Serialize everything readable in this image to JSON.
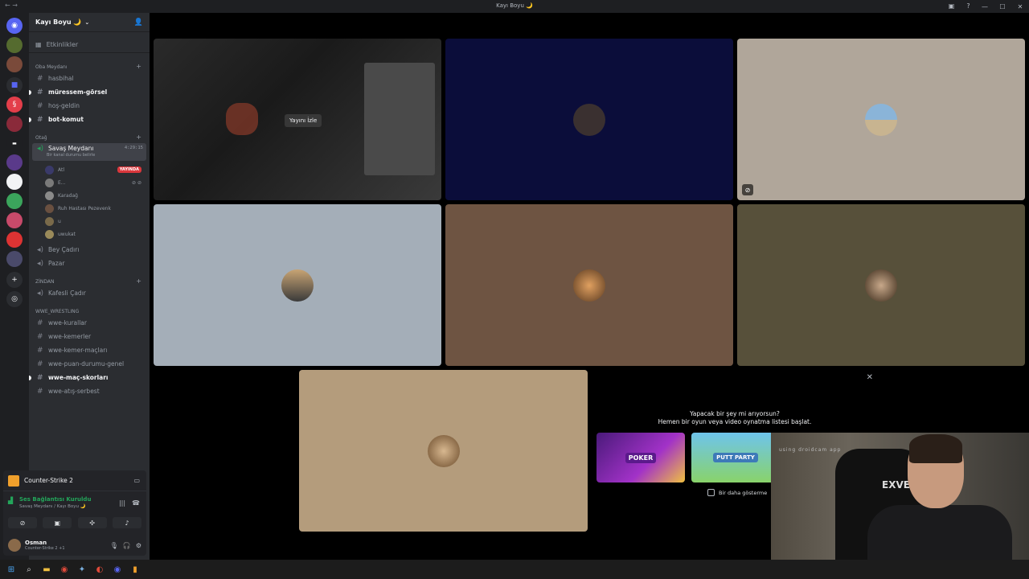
{
  "window": {
    "title": "Kayı Boyu 🌙"
  },
  "server": {
    "name": "Kayı Boyu 🌙",
    "events_label": "Etkinlikler"
  },
  "categories": {
    "oba": "Oba Meydanı",
    "otag": "Otağ",
    "zindan": "ZİNDAN",
    "wwe": "WWE_WRESTLING"
  },
  "channels": {
    "hasbihal": "hasbihal",
    "muressem": "müressem-görsel",
    "hos_geldin": "hoş-geldin",
    "bot_komut": "bot-komut",
    "savas": "Savaş Meydanı",
    "savas_status": "Bir kanal durumu belirle",
    "savas_timer": "4:29:15",
    "bey_cadiri": "Bey Çadırı",
    "pazar": "Pazar",
    "kafesli": "Kafesli Çadır",
    "wwe_kurallar": "wwe-kurallar",
    "wwe_kemerler": "wwe-kemerler",
    "wwe_kemer_maclari": "wwe-kemer-maçları",
    "wwe_puan": "wwe-puan-durumu-genel",
    "wwe_mac_skorlari": "wwe-maç-skorları",
    "wwe_atis": "wwe-atış-serbest"
  },
  "voice_users": [
    "Atl",
    "E...",
    "Karadağ",
    "Ruh Hastası Pezevenk",
    "u",
    "uwukat"
  ],
  "live_badge": "YAYINDA",
  "watch_stream": "Yayını İzle",
  "activity_prompt": {
    "line1": "Yapacak bir şey mi arıyorsun?",
    "line2": "Hemen bir oyun veya video oynatma listesi başlat.",
    "card1": "POKER",
    "card2": "PUTT PARTY",
    "dont_show": "Bir daha gösterme"
  },
  "panel": {
    "game": "Counter-Strike 2",
    "voice_connected": "Ses Bağlantısı Kuruldu",
    "voice_location": "Savaş Meydanı / Kayı Boyu 🌙",
    "user_name": "Osman",
    "user_status": "Counter-Strike 2 +1"
  },
  "webcam": {
    "watermark": "using droidcam app",
    "chair_brand": "EXVEGA"
  },
  "colors": {
    "tile_blue": "#0b0d3a",
    "tile_beige": "#b0a69a",
    "tile_slate": "#a4aeb8",
    "tile_brown": "#6e5442",
    "tile_olive": "#57503a",
    "tile_tan": "#b49c7c",
    "online": "#23a55a",
    "live": "#da373c"
  }
}
